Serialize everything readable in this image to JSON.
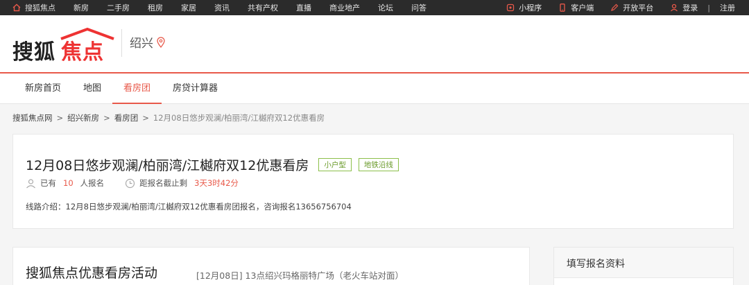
{
  "topbar": {
    "home_label": "搜狐焦点",
    "nav": [
      "新房",
      "二手房",
      "租房",
      "家居",
      "资讯",
      "共有产权",
      "直播",
      "商业地产",
      "论坛",
      "问答"
    ],
    "right": {
      "miniprogram": "小程序",
      "client": "客户端",
      "open_platform": "开放平台",
      "login": "登录",
      "sep": "|",
      "register": "注册"
    }
  },
  "header": {
    "logo_part1": "搜狐",
    "logo_part2": "焦点",
    "city": "绍兴"
  },
  "subnav": {
    "tabs": [
      "新房首页",
      "地图",
      "看房团",
      "房贷计算器"
    ],
    "active_index": 2
  },
  "breadcrumb": {
    "items": [
      "搜狐焦点网",
      "绍兴新房",
      "看房团"
    ],
    "current": "12月08日悠步观澜/柏丽湾/江樾府双12优惠看房",
    "arrow": ">"
  },
  "tour": {
    "title": "12月08日悠步观澜/柏丽湾/江樾府双12优惠看房",
    "tags": [
      "小户型",
      "地铁沿线"
    ],
    "signup_prefix": "已有",
    "signup_count": "10",
    "signup_suffix": "人报名",
    "deadline_label": "距报名截止剩",
    "deadline_value": "3天3时42分",
    "route": "线路介绍：12月8日悠步观澜/柏丽湾/江樾府双12优惠看房团报名，咨询报名13656756704"
  },
  "activity": {
    "title": "搜狐焦点优惠看房活动",
    "subtitle": "[12月08日] 13点绍兴玛格丽特广场（老火车站对面）"
  },
  "form": {
    "title": "填写报名资料"
  },
  "colors": {
    "accent": "#e8594a",
    "tag_green": "#6a9a2a",
    "topbar_bg": "#2b2b2b"
  }
}
